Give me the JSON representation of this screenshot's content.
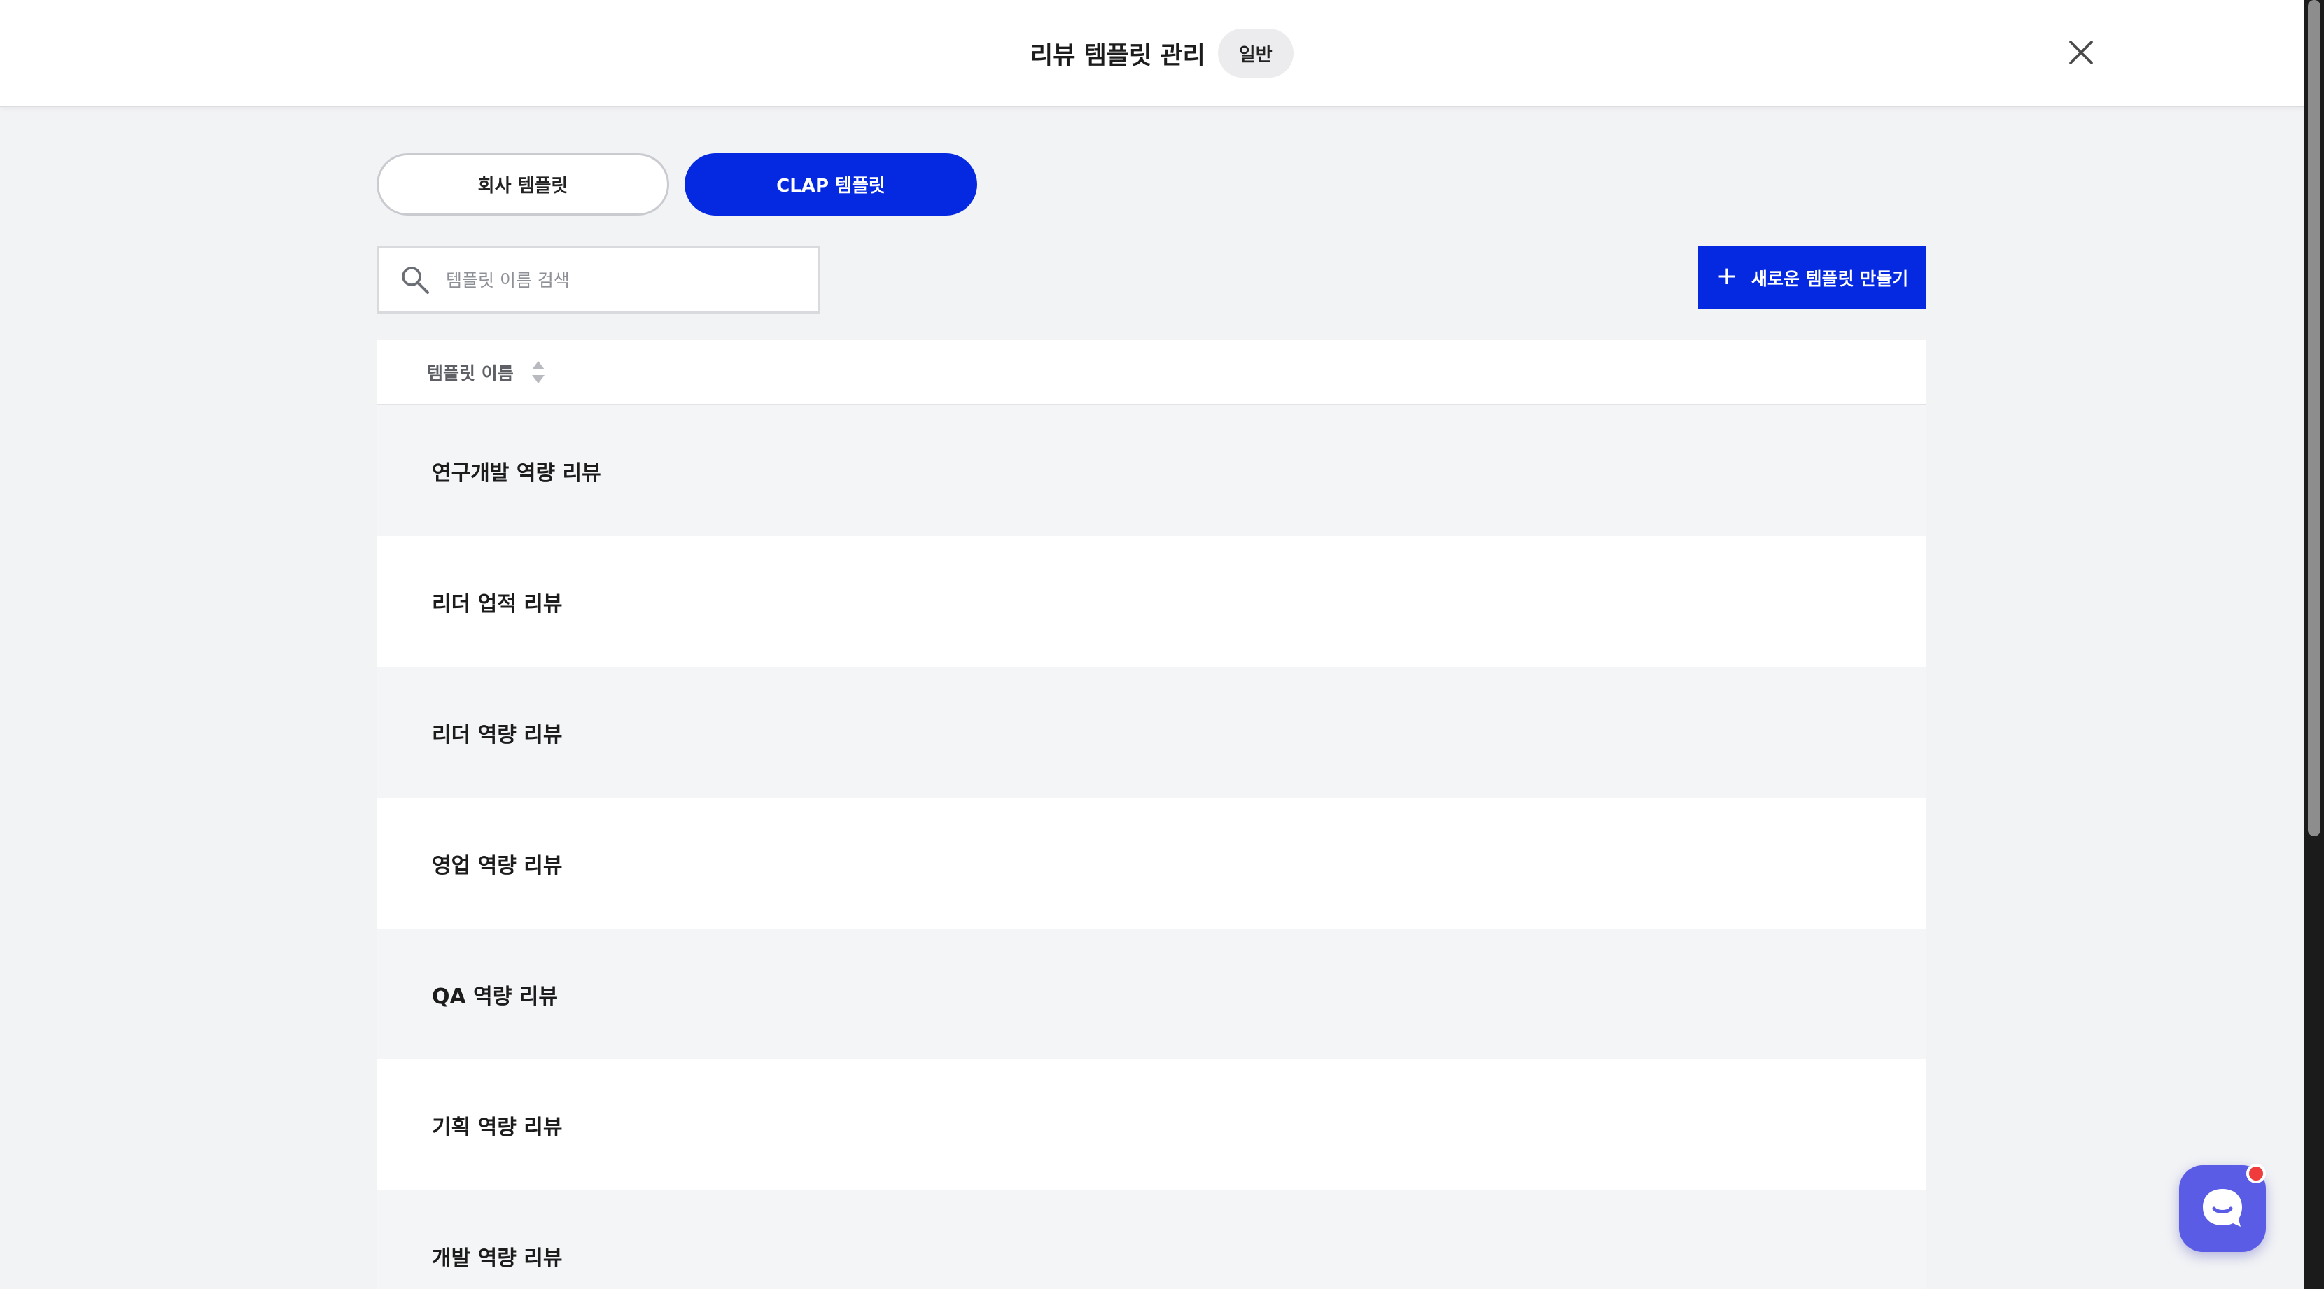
{
  "header": {
    "title": "리뷰 템플릿 관리",
    "badge": "일반",
    "close_icon": "close-icon"
  },
  "tabs": [
    {
      "label": "회사 템플릿",
      "active": false
    },
    {
      "label": "CLAP 템플릿",
      "active": true
    }
  ],
  "search": {
    "placeholder": "템플릿 이름 검색",
    "value": "",
    "icon": "search-icon"
  },
  "new_button": {
    "label": "새로운 템플릿 만들기",
    "icon": "plus-icon"
  },
  "table": {
    "column_header": "템플릿 이름",
    "sort_icon": "sort-icon",
    "rows": [
      "연구개발 역량 리뷰",
      "리더 업적 리뷰",
      "리더 역량 리뷰",
      "영업 역량 리뷰",
      "QA 역량 리뷰",
      "기획 역량 리뷰",
      "개발 역량 리뷰"
    ]
  },
  "chat": {
    "icon": "chat-icon",
    "has_notification": true
  },
  "colors": {
    "accent": "#0529e0",
    "page_background": "#f2f3f5",
    "chat": "#5a5ce6",
    "notification": "#ef3b3b"
  }
}
